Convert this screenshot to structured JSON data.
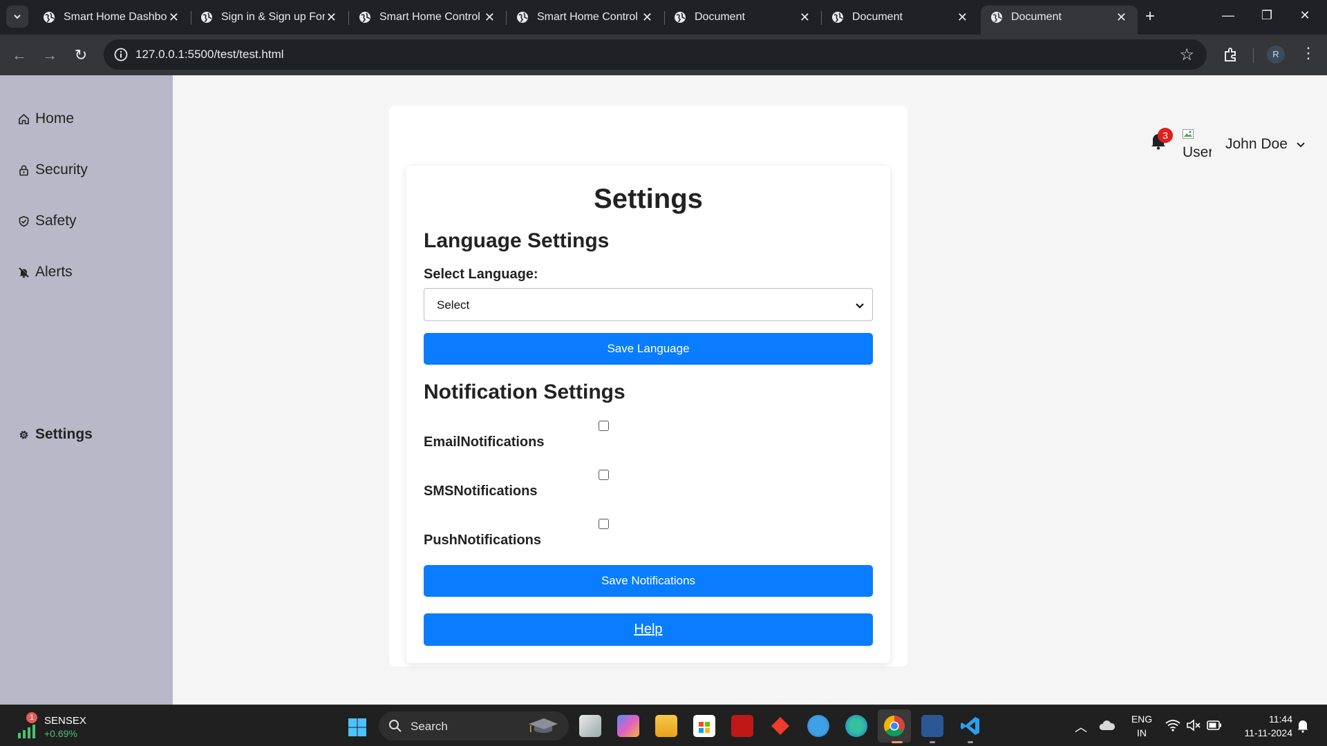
{
  "browser": {
    "tabs": [
      {
        "title": "Smart Home Dashboard"
      },
      {
        "title": "Sign in & Sign up Form"
      },
      {
        "title": "Smart Home Control"
      },
      {
        "title": "Smart Home Control"
      },
      {
        "title": "Document"
      },
      {
        "title": "Document"
      },
      {
        "title": "Document"
      }
    ],
    "active_tab_index": 6,
    "url": "127.0.0.1:5500/test/test.html",
    "profile_initial": "R"
  },
  "sidebar": {
    "items": [
      {
        "label": "Home",
        "icon": "home-icon"
      },
      {
        "label": "Security",
        "icon": "lock-icon"
      },
      {
        "label": "Safety",
        "icon": "shield-icon"
      },
      {
        "label": "Alerts",
        "icon": "bell-off-icon"
      },
      {
        "label": "Settings",
        "icon": "gear-icon",
        "active": true
      }
    ]
  },
  "header": {
    "notification_count": "3",
    "avatar_alt": "User",
    "user_name": "John Doe"
  },
  "settings": {
    "title": "Settings",
    "language": {
      "section_title": "Language Settings",
      "select_label": "Select Language:",
      "selected_value": "Select",
      "save_label": "Save Language"
    },
    "notifications": {
      "section_title": "Notification Settings",
      "options": [
        {
          "label": "EmailNotifications",
          "checked": false
        },
        {
          "label": "SMSNotifications",
          "checked": false
        },
        {
          "label": "PushNotifications",
          "checked": false
        }
      ],
      "save_label": "Save Notifications"
    },
    "help_label": "Help"
  },
  "colors": {
    "primary_button": "#0a7cff",
    "sidebar_bg": "#b8b8c9",
    "badge": "#e0201b"
  },
  "taskbar": {
    "stock": {
      "badge": "1",
      "name": "SENSEX",
      "change": "+0.69%"
    },
    "search_placeholder": "Search",
    "language_line1": "ENG",
    "language_line2": "IN",
    "time": "11:44",
    "date": "11-11-2024"
  }
}
